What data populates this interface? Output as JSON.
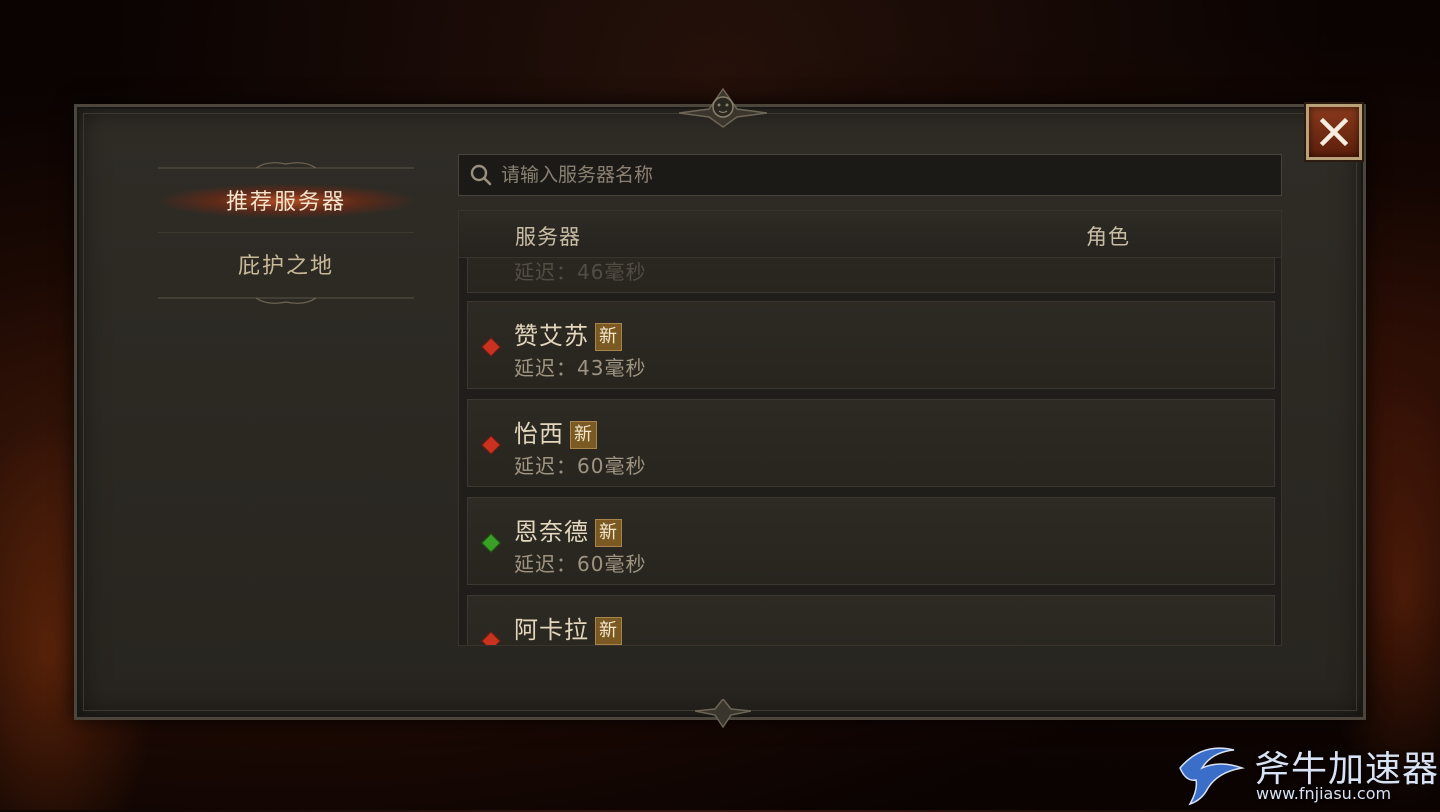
{
  "search": {
    "placeholder": "请输入服务器名称"
  },
  "sidebar": {
    "items": [
      {
        "label": "推荐服务器",
        "active": true
      },
      {
        "label": "庇护之地",
        "active": false
      }
    ]
  },
  "table": {
    "headers": {
      "server": "服务器",
      "role": "角色"
    },
    "rows": [
      {
        "name": "",
        "latency": "延迟：46毫秒",
        "is_new": false,
        "status_color": "#c8321e"
      },
      {
        "name": "赞艾苏",
        "badge": "新",
        "latency": "延迟：43毫秒",
        "status_color": "#c8321e"
      },
      {
        "name": "怡西",
        "badge": "新",
        "latency": "延迟：60毫秒",
        "status_color": "#c8321e"
      },
      {
        "name": "恩奈德",
        "badge": "新",
        "latency": "延迟：60毫秒",
        "status_color": "#3aa025"
      },
      {
        "name": "阿卡拉",
        "badge": "新",
        "latency": "",
        "status_color": "#c8321e"
      }
    ]
  },
  "watermark": {
    "brand": "斧牛加速器",
    "url": "www.fnjiasu.com"
  },
  "icons": {
    "search": "search-icon",
    "close": "close-icon"
  }
}
